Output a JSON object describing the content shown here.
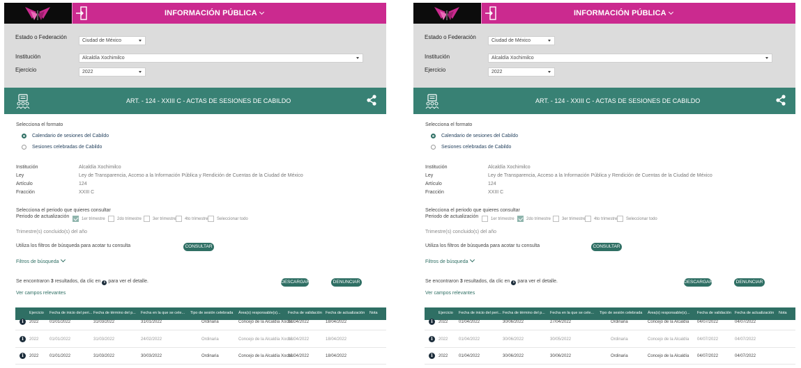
{
  "header": {
    "title": "INFORMACIÓN PÚBLICA"
  },
  "colors": {
    "magenta": "#cb2a8f",
    "teal": "#388174",
    "dark_teal": "#2f6f64",
    "filter_bg": "#dcdcdc"
  },
  "icons": {
    "logo": "butterfly-logo-icon",
    "login": "login-icon",
    "section": "people-document-icon",
    "share": "share-icon",
    "info": "info-icon",
    "dropdown": "chevron-down-icon"
  },
  "filters": {
    "estado_label": "Estado o Federación",
    "estado_value": "Ciudad de México",
    "institucion_label": "Institución",
    "institucion_value": "Alcaldía Xochimilco",
    "ejercicio_label": "Ejercicio",
    "ejercicio_value": "2022"
  },
  "section": {
    "title": "ART. - 124 - XXIII C - ACTAS DE SESIONES DE CABILDO"
  },
  "formato": {
    "label": "Selecciona el formato",
    "options": [
      "Calendario de sesiones del Cabildo",
      "Sesiones celebradas de Cabildo"
    ]
  },
  "details": {
    "institucion_label": "Institución",
    "institucion_value": "Alcaldía Xochimilco",
    "ley_label": "Ley",
    "ley_value": "Ley de Transparencia, Acceso a la Información Pública y Rendición de Cuentas de la Ciudad de México",
    "articulo_label": "Artículo",
    "articulo_value": "124",
    "fraccion_label": "Fracción",
    "fraccion_value": "XXIII C"
  },
  "periodo": {
    "prompt": "Selecciona el periodo que quieres consultar",
    "label": "Periodo de actualización",
    "options": [
      "1er trimestre",
      "2do trimestre",
      "3er trimestre",
      "4to trimestre",
      "Seleccionar todo"
    ]
  },
  "trimestres_label": "Trimestre(s) concluido(s) del año",
  "consultar": {
    "hint": "Utiliza los filtros de búsqueda para acotar tu consulta",
    "button": "CONSULTAR"
  },
  "filtros_link": "Filtros de búsqueda",
  "results": {
    "text_before": "Se encontraron",
    "count": "3",
    "text_mid": "resultados, da clic en",
    "text_after": "para ver el detalle."
  },
  "descargar_button": "DESCARGAR",
  "denunciar_button": "DENUNCIAR",
  "ver_campos_link": "Ver campos relevantes",
  "table": {
    "columns": [
      "Ejercicio",
      "Fecha de inicio del peri...",
      "Fecha de término del p...",
      "Fecha en la que se cele...",
      "Tipo de sesión celebrada",
      "Área(s) responsable(s)...",
      "Fecha de validación",
      "Fecha de actualización",
      "Nota"
    ]
  },
  "panels": [
    {
      "checked_period": 0,
      "rows": [
        [
          "2022",
          "01/01/2022",
          "31/03/2022",
          "31/01/2022",
          "Ordinaria",
          "Concejo de la Alcaldía Xochi...",
          "18/04/2022",
          "18/04/2022",
          ""
        ],
        [
          "2022",
          "01/01/2022",
          "31/03/2022",
          "24/02/2022",
          "Ordinaria",
          "Concejo de la Alcaldía Xochi...",
          "18/04/2022",
          "18/04/2022",
          ""
        ],
        [
          "2022",
          "01/01/2022",
          "31/03/2022",
          "30/03/2022",
          "Ordinaria",
          "Concejo de la Alcaldía Xochi...",
          "18/04/2022",
          "18/04/2022",
          ""
        ]
      ]
    },
    {
      "checked_period": 1,
      "rows": [
        [
          "2022",
          "01/04/2022",
          "30/06/2022",
          "27/04/2022",
          "Ordinaria",
          "Concejo de la Alcaldía",
          "04/07/2022",
          "04/07/2022",
          ""
        ],
        [
          "2022",
          "01/04/2022",
          "30/06/2022",
          "30/05/2022",
          "Ordinaria",
          "Concejo de la Alcaldía",
          "04/07/2022",
          "04/07/2022",
          ""
        ],
        [
          "2022",
          "01/04/2022",
          "30/06/2022",
          "30/06/2022",
          "Ordinaria",
          "Concejo de la Alcaldía",
          "04/07/2022",
          "04/07/2022",
          ""
        ]
      ]
    }
  ]
}
